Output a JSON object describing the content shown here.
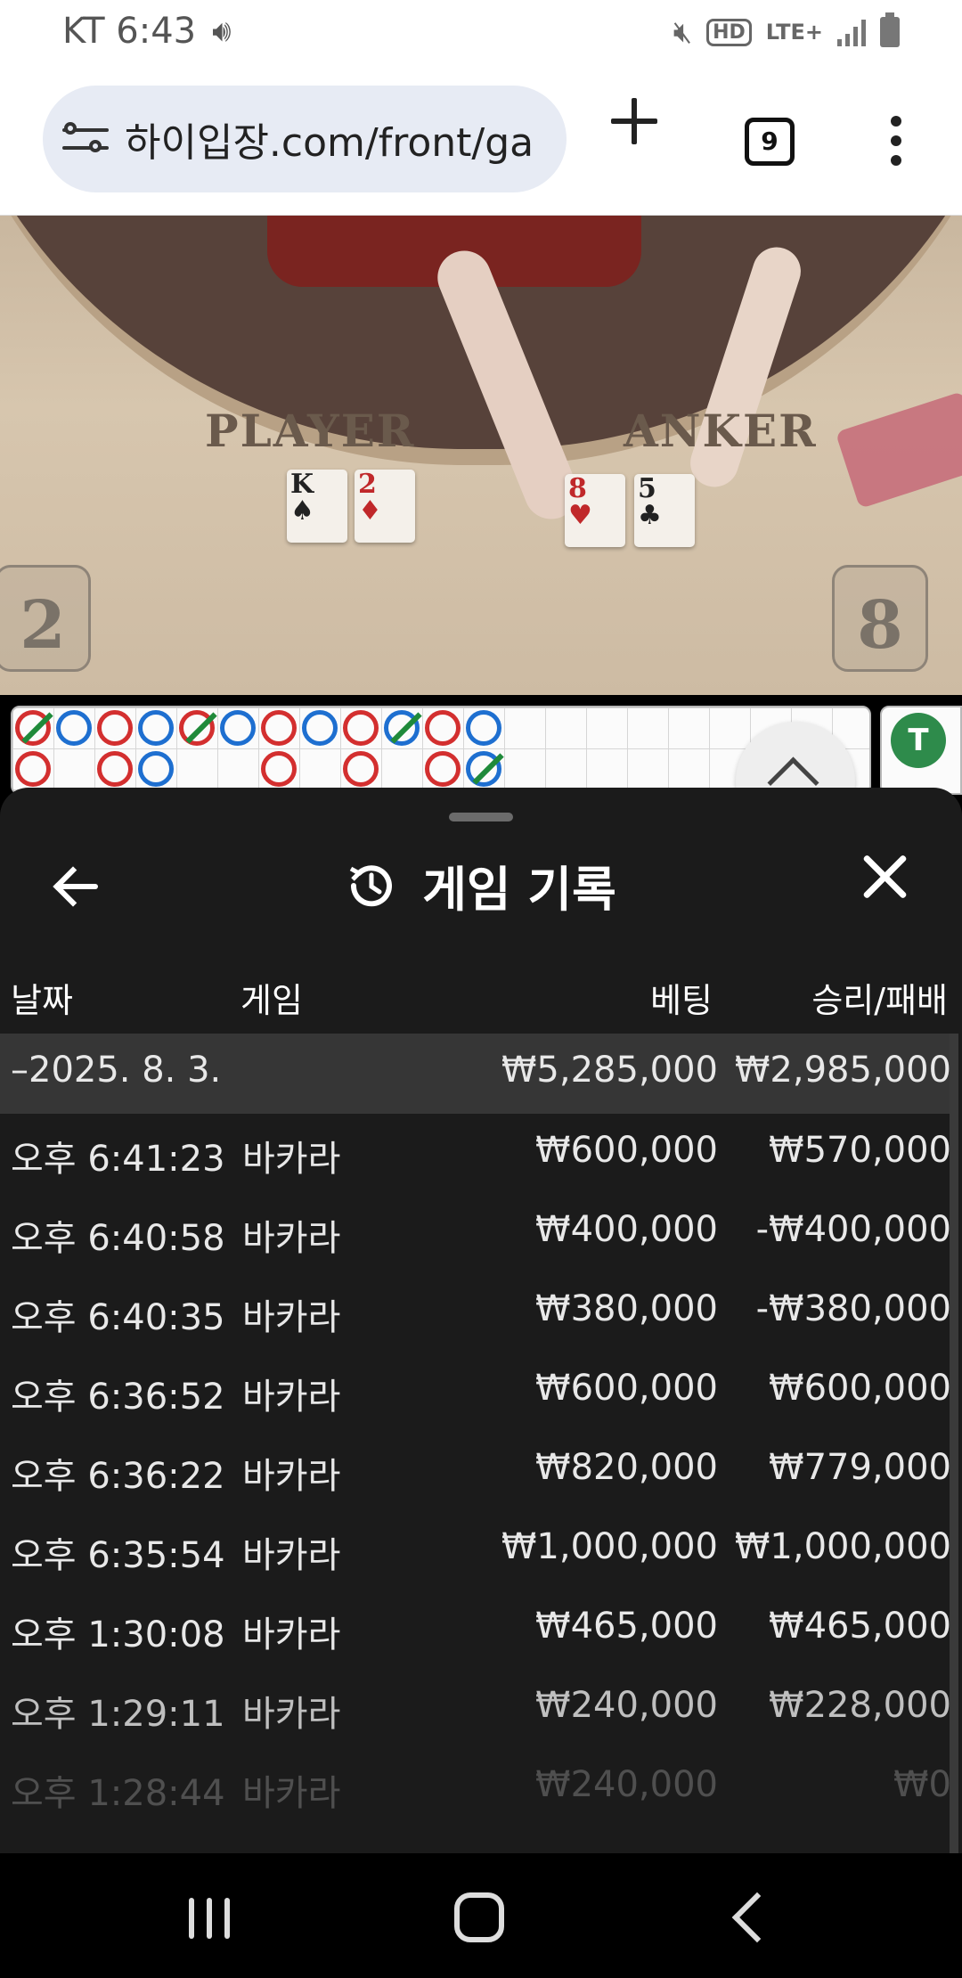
{
  "status_bar": {
    "carrier_time": "KT 6:43",
    "hd_label": "HD",
    "network_label": "LTE+"
  },
  "browser": {
    "url": "하이입장.com/front/ga",
    "tab_count": "9"
  },
  "video": {
    "player_label": "PLAYER",
    "banker_label": "ANKER",
    "player_score": "2",
    "banker_score": "8",
    "player_cards": [
      {
        "rank": "K",
        "suit": "♠",
        "color": "black"
      },
      {
        "rank": "2",
        "suit": "♦",
        "color": "red"
      }
    ],
    "banker_cards": [
      {
        "rank": "8",
        "suit": "♥",
        "color": "red"
      },
      {
        "rank": "5",
        "suit": "♣",
        "color": "black"
      }
    ]
  },
  "roadmap": {
    "tie_badge": "T",
    "beads": [
      {
        "col": 0,
        "row": 0,
        "color": "r",
        "tie": true
      },
      {
        "col": 1,
        "row": 0,
        "color": "b",
        "tie": false
      },
      {
        "col": 2,
        "row": 0,
        "color": "r",
        "tie": false
      },
      {
        "col": 3,
        "row": 0,
        "color": "b",
        "tie": false
      },
      {
        "col": 4,
        "row": 0,
        "color": "r",
        "tie": true
      },
      {
        "col": 5,
        "row": 0,
        "color": "b",
        "tie": false
      },
      {
        "col": 6,
        "row": 0,
        "color": "r",
        "tie": false
      },
      {
        "col": 7,
        "row": 0,
        "color": "b",
        "tie": false
      },
      {
        "col": 8,
        "row": 0,
        "color": "r",
        "tie": false
      },
      {
        "col": 9,
        "row": 0,
        "color": "b",
        "tie": true
      },
      {
        "col": 10,
        "row": 0,
        "color": "r",
        "tie": false
      },
      {
        "col": 11,
        "row": 0,
        "color": "b",
        "tie": false
      },
      {
        "col": 0,
        "row": 1,
        "color": "r",
        "tie": false
      },
      {
        "col": 2,
        "row": 1,
        "color": "r",
        "tie": false
      },
      {
        "col": 3,
        "row": 1,
        "color": "b",
        "tie": false
      },
      {
        "col": 6,
        "row": 1,
        "color": "r",
        "tie": false
      },
      {
        "col": 8,
        "row": 1,
        "color": "r",
        "tie": false
      },
      {
        "col": 10,
        "row": 1,
        "color": "r",
        "tie": false
      },
      {
        "col": 11,
        "row": 1,
        "color": "b",
        "tie": true
      }
    ]
  },
  "sheet": {
    "title": "게임 기록",
    "columns": {
      "date": "날짜",
      "game": "게임",
      "bet": "베팅",
      "win_loss": "승리/패배"
    },
    "summary": {
      "date": "–2025. 8. 3.",
      "bet": "₩5,285,000",
      "win_loss": "₩2,985,000"
    },
    "rows": [
      {
        "time": "오후 6:41:23",
        "game": "바카라",
        "bet": "₩600,000",
        "win_loss": "₩570,000"
      },
      {
        "time": "오후 6:40:58",
        "game": "바카라",
        "bet": "₩400,000",
        "win_loss": "-₩400,000"
      },
      {
        "time": "오후 6:40:35",
        "game": "바카라",
        "bet": "₩380,000",
        "win_loss": "-₩380,000"
      },
      {
        "time": "오후 6:36:52",
        "game": "바카라",
        "bet": "₩600,000",
        "win_loss": "₩600,000"
      },
      {
        "time": "오후 6:36:22",
        "game": "바카라",
        "bet": "₩820,000",
        "win_loss": "₩779,000"
      },
      {
        "time": "오후 6:35:54",
        "game": "바카라",
        "bet": "₩1,000,000",
        "win_loss": "₩1,000,000"
      },
      {
        "time": "오후 1:30:08",
        "game": "바카라",
        "bet": "₩465,000",
        "win_loss": "₩465,000"
      },
      {
        "time": "오후 1:29:11",
        "game": "바카라",
        "bet": "₩240,000",
        "win_loss": "₩228,000"
      },
      {
        "time": "오후 1:28:44",
        "game": "바카라",
        "bet": "₩240,000",
        "win_loss": "₩0"
      }
    ]
  }
}
